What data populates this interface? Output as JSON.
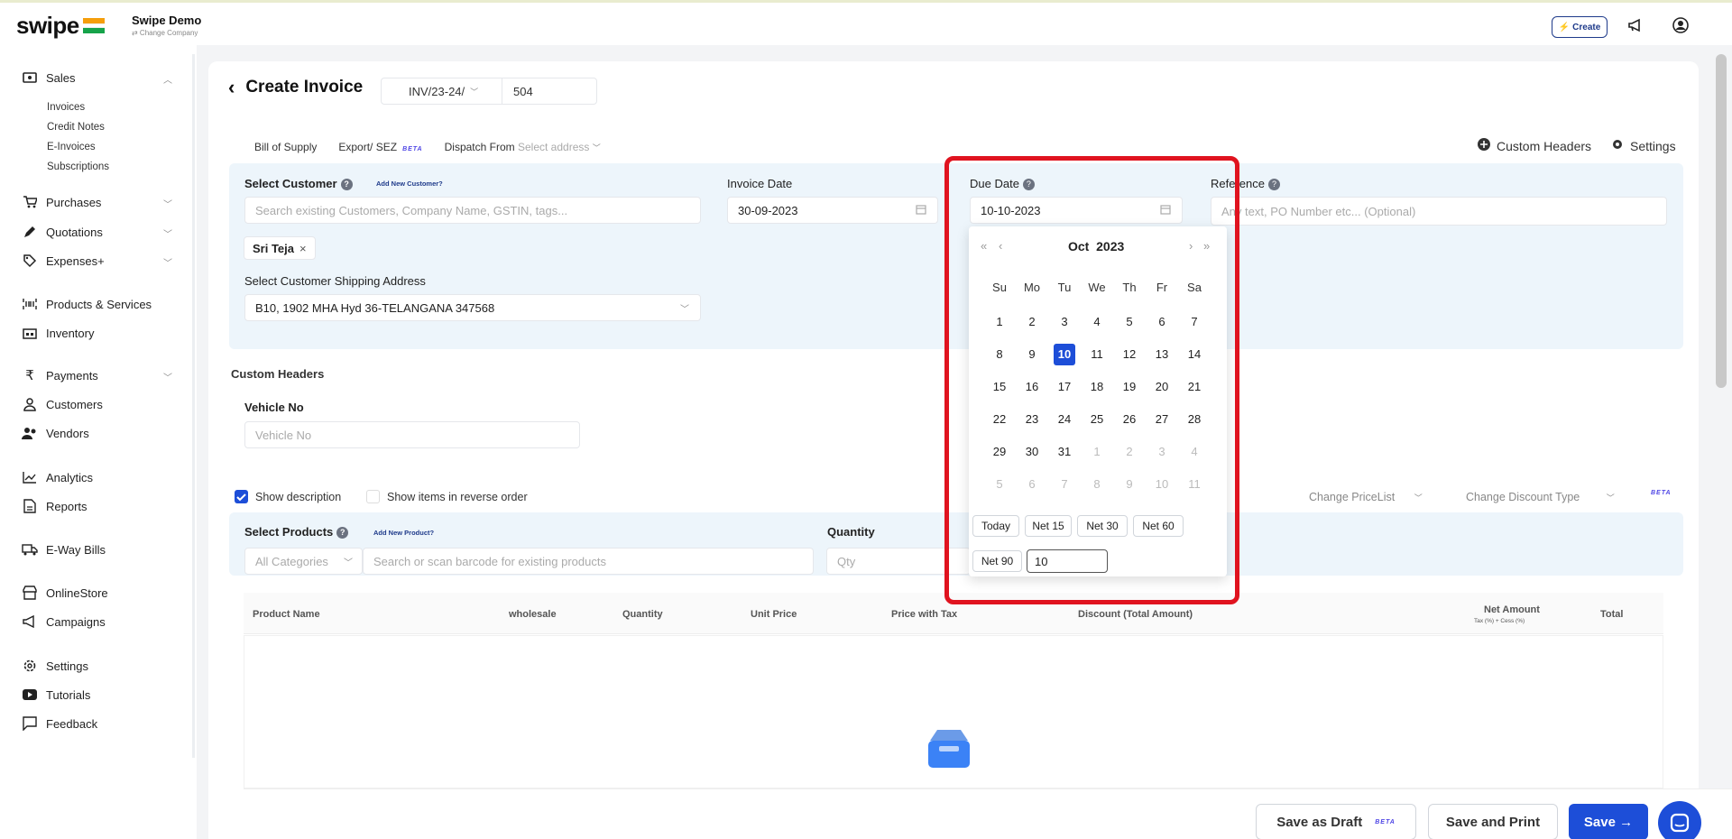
{
  "topbar": {
    "logo": "swipe",
    "company": "Swipe Demo",
    "company_sub": "⇄ Change Company",
    "create_label": "Create"
  },
  "sidebar": {
    "sales": "Sales",
    "sales_sub": [
      "Invoices",
      "Credit Notes",
      "E-Invoices",
      "Subscriptions"
    ],
    "purchases": "Purchases",
    "quotations": "Quotations",
    "expenses": "Expenses+",
    "products": "Products & Services",
    "inventory": "Inventory",
    "payments": "Payments",
    "customers": "Customers",
    "vendors": "Vendors",
    "analytics": "Analytics",
    "reports": "Reports",
    "eway": "E-Way Bills",
    "onlinestore": "OnlineStore",
    "campaigns": "Campaigns",
    "settings": "Settings",
    "tutorials": "Tutorials",
    "feedback": "Feedback"
  },
  "header": {
    "title": "Create Invoice",
    "series_prefix": "INV/23-24/",
    "series_number": "504"
  },
  "options": {
    "bill_of_supply": "Bill of Supply",
    "export_sez": "Export/ SEZ",
    "beta": "BETA",
    "dispatch_from": "Dispatch From",
    "dispatch_placeholder": "Select address",
    "custom_headers": "Custom Headers",
    "settings": "Settings"
  },
  "customer": {
    "label": "Select Customer",
    "add_new": "Add New Customer?",
    "search_placeholder": "Search existing Customers, Company Name, GSTIN, tags...",
    "selected": "Sri Teja",
    "shipping_label": "Select Customer Shipping Address",
    "shipping_value": "B10, 1902 MHA Hyd 36-TELANGANA 347568"
  },
  "invoice_date": {
    "label": "Invoice Date",
    "value": "30-09-2023"
  },
  "due_date": {
    "label": "Due Date",
    "value": "10-10-2023"
  },
  "reference": {
    "label": "Reference",
    "placeholder": "Any text, PO Number etc... (Optional)"
  },
  "custom_headers": {
    "title": "Custom Headers",
    "vehicle_label": "Vehicle No",
    "vehicle_placeholder": "Vehicle No"
  },
  "items_options": {
    "show_description": "Show description",
    "show_description_checked": true,
    "reverse_order": "Show items in reverse order",
    "change_pricelist": "Change PriceList",
    "change_discount": "Change Discount Type",
    "beta": "BETA"
  },
  "products": {
    "label": "Select Products",
    "add_new": "Add New Product?",
    "category": "All Categories",
    "search_placeholder": "Search or scan barcode for existing products",
    "quantity_label": "Quantity",
    "qty_placeholder": "Qty"
  },
  "table": {
    "columns": [
      "Product Name",
      "wholesale",
      "Quantity",
      "Unit Price",
      "Price with Tax",
      "Discount (Total Amount)",
      "Net Amount",
      "Total"
    ],
    "net_amount_sub": "Tax (%) + Cess (%)"
  },
  "calendar": {
    "month": "Oct",
    "year": "2023",
    "weekdays": [
      "Su",
      "Mo",
      "Tu",
      "We",
      "Th",
      "Fr",
      "Sa"
    ],
    "weeks": [
      [
        "1",
        "2",
        "3",
        "4",
        "5",
        "6",
        "7"
      ],
      [
        "8",
        "9",
        "10",
        "11",
        "12",
        "13",
        "14"
      ],
      [
        "15",
        "16",
        "17",
        "18",
        "19",
        "20",
        "21"
      ],
      [
        "22",
        "23",
        "24",
        "25",
        "26",
        "27",
        "28"
      ],
      [
        "29",
        "30",
        "31",
        "1",
        "2",
        "3",
        "4"
      ],
      [
        "5",
        "6",
        "7",
        "8",
        "9",
        "10",
        "11"
      ]
    ],
    "selected_day": "10",
    "presets": [
      "Today",
      "Net 15",
      "Net 30",
      "Net 60",
      "Net 90"
    ],
    "custom_net_value": "10"
  },
  "actions": {
    "save_draft": "Save as Draft",
    "beta": "BETA",
    "save_print": "Save and Print",
    "save": "Save →"
  },
  "colors": {
    "primary": "#1d4ed8",
    "panel_bg": "#edf5fb",
    "highlight": "#e0131f"
  }
}
